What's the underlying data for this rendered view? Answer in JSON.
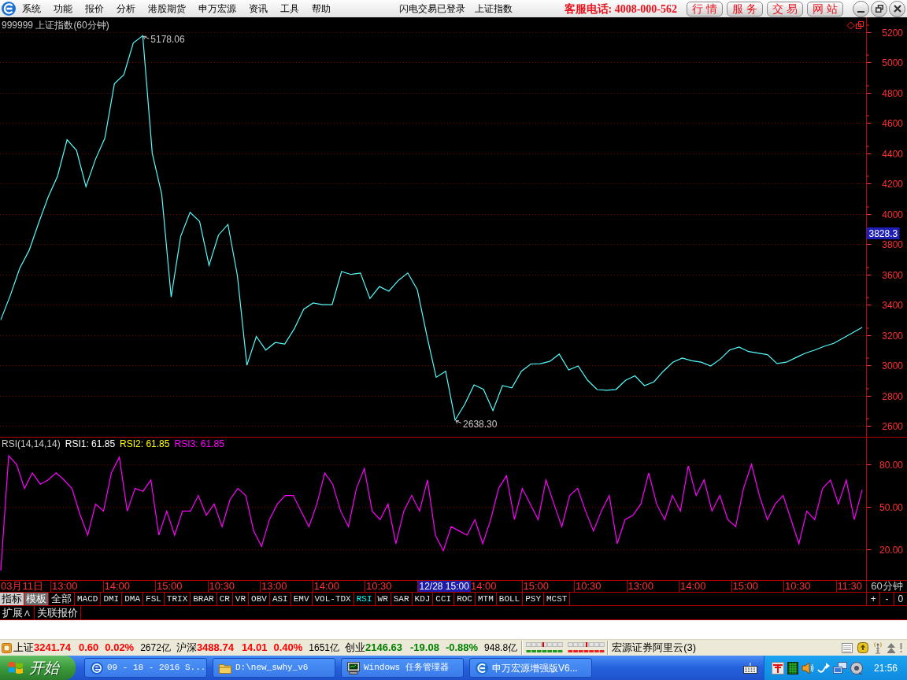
{
  "menu_bar": {
    "items": [
      "系统",
      "功能",
      "报价",
      "分析",
      "港股期货",
      "申万宏源",
      "资讯",
      "工具",
      "帮助"
    ],
    "login_status": "闪电交易已登录",
    "symbol": "上证指数",
    "hotline": "客服电话: 4008-000-562",
    "buttons": [
      "行 情",
      "服 务",
      "交 易",
      "网 站"
    ]
  },
  "price_chart": {
    "chart_data": {
      "type": "line",
      "title": "999999 上证指数(60分钟)",
      "ylim": [
        2527,
        5299
      ],
      "yticks": [
        2600,
        2800,
        3000,
        3200,
        3400,
        3600,
        3800,
        4000,
        4200,
        4400,
        4600,
        4800,
        5000,
        5200
      ],
      "grid": true,
      "series": [
        {
          "color": "#54fcfc",
          "values": [
            3300,
            3460,
            3640,
            3760,
            3940,
            4110,
            4250,
            4490,
            4420,
            4180,
            4360,
            4500,
            4860,
            4920,
            5130,
            5178,
            4400,
            4130,
            3450,
            3850,
            4010,
            3950,
            3660,
            3860,
            3930,
            3593,
            3000,
            3190,
            3100,
            3150,
            3140,
            3240,
            3370,
            3411,
            3400,
            3400,
            3619,
            3600,
            3610,
            3440,
            3520,
            3489,
            3560,
            3610,
            3500,
            3200,
            2920,
            2960,
            2638,
            2740,
            2870,
            2840,
            2700,
            2865,
            2850,
            2960,
            3008,
            3010,
            3025,
            3073,
            2969,
            2995,
            2900,
            2839,
            2835,
            2840,
            2900,
            2930,
            2865,
            2890,
            2960,
            3020,
            3047,
            3030,
            3020,
            2995,
            3040,
            3100,
            3120,
            3090,
            3080,
            3070,
            3011,
            3020,
            3050,
            3080,
            3100,
            3125,
            3145,
            3180,
            3215,
            3250
          ]
        }
      ],
      "annotations": [
        "5178.06",
        "2638.30"
      ]
    },
    "price_tag": "3828.3"
  },
  "rsi_chart": {
    "legend": [
      {
        "text": "RSI1: 61.85",
        "color": "#ffffff"
      },
      {
        "text": "RSI2: 61.85",
        "color": "#ffff00"
      },
      {
        "text": "RSI3: 61.85",
        "color": "#ff00ff"
      }
    ],
    "chart_data": {
      "type": "line",
      "title": "RSI(14,14,14)",
      "ylim": [
        -1.7,
        98.9
      ],
      "yticks": [
        {
          "value": 20,
          "label": "20.00"
        },
        {
          "value": 50,
          "label": "50.00"
        },
        {
          "value": 80,
          "label": "80.00"
        }
      ],
      "grid": true,
      "series": [
        {
          "color": "#ff00ff",
          "values": [
            5,
            86,
            80,
            63,
            74,
            66,
            69,
            74,
            69,
            63,
            45,
            30,
            52,
            47,
            74,
            85,
            47,
            63,
            61,
            69,
            30,
            47,
            30,
            47,
            47,
            58,
            44,
            52,
            36,
            55,
            63,
            58,
            33,
            22,
            41,
            52,
            58,
            58,
            47,
            36,
            52,
            74,
            66,
            47,
            36,
            63,
            77,
            47,
            41,
            52,
            24,
            47,
            58,
            47,
            69,
            30,
            19,
            36,
            33,
            30,
            41,
            24,
            41,
            63,
            72,
            41,
            63,
            52,
            41,
            69,
            52,
            36,
            58,
            63,
            47,
            33,
            47,
            58,
            24,
            41,
            44,
            52,
            74,
            52,
            41,
            58,
            47,
            79,
            58,
            69,
            47,
            58,
            41,
            36,
            63,
            80,
            58,
            41,
            52,
            58,
            41,
            24,
            47,
            41,
            63,
            69,
            52,
            69,
            41,
            62
          ]
        }
      ]
    }
  },
  "time_axis": {
    "labels": [
      {
        "text": "03月11日",
        "highlighted": false
      },
      {
        "text": "13:00",
        "highlighted": false
      },
      {
        "text": "14:00",
        "highlighted": false
      },
      {
        "text": "15:00",
        "highlighted": false
      },
      {
        "text": "10:30",
        "highlighted": false
      },
      {
        "text": "13:00",
        "highlighted": false
      },
      {
        "text": "14:00",
        "highlighted": false
      },
      {
        "text": "10:30",
        "highlighted": false
      },
      {
        "text": "12/28 15:00",
        "highlighted": true
      },
      {
        "text": "14:00",
        "highlighted": false
      },
      {
        "text": "15:00",
        "highlighted": false
      },
      {
        "text": "10:30",
        "highlighted": false
      },
      {
        "text": "13:00",
        "highlighted": false
      },
      {
        "text": "14:00",
        "highlighted": false
      },
      {
        "text": "15:00",
        "highlighted": false
      },
      {
        "text": "10:30",
        "highlighted": false
      },
      {
        "text": "11:30",
        "highlighted": false
      }
    ],
    "period": "60分钟"
  },
  "indicator_tabs": [
    {
      "label": "指标",
      "kind": "mode",
      "selected": true
    },
    {
      "label": "模板",
      "kind": "mode",
      "selected": false
    },
    {
      "label": "全部",
      "kind": "group",
      "selected": false
    },
    {
      "label": "MACD",
      "kind": "indicator",
      "selected": false
    },
    {
      "label": "DMI",
      "kind": "indicator",
      "selected": false
    },
    {
      "label": "DMA",
      "kind": "indicator",
      "selected": false
    },
    {
      "label": "FSL",
      "kind": "indicator",
      "selected": false
    },
    {
      "label": "TRIX",
      "kind": "indicator",
      "selected": false
    },
    {
      "label": "BRAR",
      "kind": "indicator",
      "selected": false
    },
    {
      "label": "CR",
      "kind": "indicator",
      "selected": false
    },
    {
      "label": "VR",
      "kind": "indicator",
      "selected": false
    },
    {
      "label": "OBV",
      "kind": "indicator",
      "selected": false
    },
    {
      "label": "ASI",
      "kind": "indicator",
      "selected": false
    },
    {
      "label": "EMV",
      "kind": "indicator",
      "selected": false
    },
    {
      "label": "VOL-TDX",
      "kind": "indicator",
      "selected": false
    },
    {
      "label": "RSI",
      "kind": "indicator",
      "selected": true
    },
    {
      "label": "WR",
      "kind": "indicator",
      "selected": false
    },
    {
      "label": "SAR",
      "kind": "indicator",
      "selected": false
    },
    {
      "label": "KDJ",
      "kind": "indicator",
      "selected": false
    },
    {
      "label": "CCI",
      "kind": "indicator",
      "selected": false
    },
    {
      "label": "ROC",
      "kind": "indicator",
      "selected": false
    },
    {
      "label": "MTM",
      "kind": "indicator",
      "selected": false
    },
    {
      "label": "BOLL",
      "kind": "indicator",
      "selected": false
    },
    {
      "label": "PSY",
      "kind": "indicator",
      "selected": false
    },
    {
      "label": "MCST",
      "kind": "indicator",
      "selected": false
    }
  ],
  "zoom_buttons": [
    "+",
    "-",
    "0"
  ],
  "panel_tabs": [
    "扩展∧",
    "关联报价"
  ],
  "status_bar": {
    "indices": [
      {
        "name": "上证",
        "price": "3241.74",
        "change": "0.60",
        "percent": "0.02%",
        "turnover": "2672亿",
        "rising": true
      },
      {
        "name": "沪深",
        "price": "3488.74",
        "change": "14.01",
        "percent": "0.40%",
        "turnover": "1651亿",
        "rising": true
      },
      {
        "name": "创业",
        "price": "2146.63",
        "change": "-19.08",
        "percent": "-0.88%",
        "turnover": "948.8亿",
        "rising": false
      }
    ],
    "server": "宏源证券阿里云(3)"
  },
  "taskbar": {
    "start_label": "开始",
    "tasks": [
      {
        "label": "09 - 18 - 2016 S...",
        "kind": "browser"
      },
      {
        "label": "D:\\new_swhy_v6",
        "kind": "folder"
      },
      {
        "label": "Windows 任务管理器",
        "kind": "monitor"
      },
      {
        "label": "申万宏源增强版V6...",
        "kind": "app"
      }
    ],
    "clock": "21:56"
  }
}
